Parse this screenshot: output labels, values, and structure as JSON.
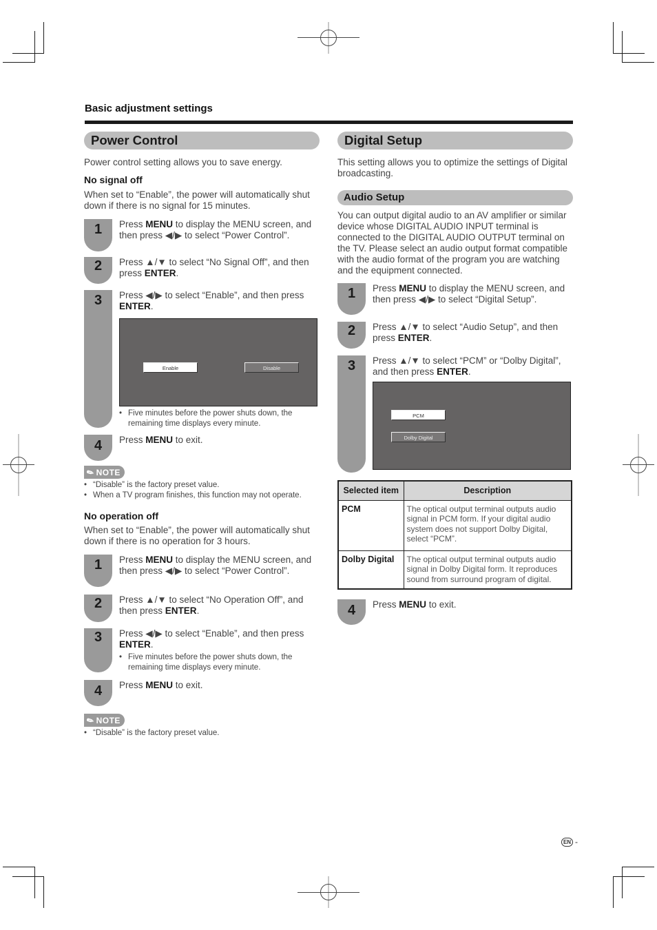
{
  "header": {
    "section_label": "Basic adjustment settings"
  },
  "power_control": {
    "title": "Power Control",
    "intro": "Power control setting allows you to save energy.",
    "no_signal_off": {
      "heading": "No signal off",
      "description": "When set to “Enable”, the power will automatically shut down if there is no signal for 15 minutes.",
      "steps": [
        {
          "num": "1",
          "pre": "Press ",
          "bold1": "MENU",
          "post": " to display the MENU screen, and then press ◀/▶ to select “Power Control”."
        },
        {
          "num": "2",
          "pre": "Press ▲/▼ to select “No Signal Off”, and then press ",
          "bold1": "ENTER",
          "post": "."
        },
        {
          "num": "3",
          "pre": "Press ◀/▶ to select “Enable”, and then press ",
          "bold1": "ENTER",
          "post": "."
        },
        {
          "num": "4",
          "pre": "Press ",
          "bold1": "MENU",
          "post": " to exit."
        }
      ],
      "screen": {
        "options": [
          "Enable",
          "Disable"
        ],
        "selected": "Enable"
      },
      "step3_bullet": "Five minutes before the power shuts down, the remaining time displays every minute.",
      "note_label": "NOTE",
      "notes": [
        "“Disable” is the factory preset value.",
        "When a TV program finishes, this function may not operate."
      ]
    },
    "no_operation_off": {
      "heading": "No operation off",
      "description": "When set to “Enable”, the power will automatically shut down if there is no operation for 3 hours.",
      "steps": [
        {
          "num": "1",
          "pre": "Press ",
          "bold1": "MENU",
          "post": " to display the MENU screen, and then press ◀/▶ to select “Power Control”."
        },
        {
          "num": "2",
          "pre": "Press ▲/▼ to select “No Operation Off”, and then press ",
          "bold1": "ENTER",
          "post": "."
        },
        {
          "num": "3",
          "pre": "Press ◀/▶ to select “Enable”, and then press ",
          "bold1": "ENTER",
          "post": "."
        },
        {
          "num": "4",
          "pre": "Press ",
          "bold1": "MENU",
          "post": " to exit."
        }
      ],
      "step3_bullet": "Five minutes before the power shuts down, the remaining time displays every minute.",
      "note_label": "NOTE",
      "notes": [
        "“Disable” is the factory preset value."
      ]
    }
  },
  "digital_setup": {
    "title": "Digital Setup",
    "intro": "This setting allows you to optimize the settings of Digital broadcasting.",
    "audio_setup": {
      "title": "Audio Setup",
      "description": "You can output digital audio to an AV amplifier or similar device whose DIGITAL AUDIO INPUT terminal is connected to the DIGITAL AUDIO OUTPUT terminal on the TV. Please select an audio output format compatible with the audio format of the program you are watching and the equipment connected.",
      "steps": [
        {
          "num": "1",
          "pre": "Press ",
          "bold1": "MENU",
          "post": " to display the MENU screen, and then press ◀/▶ to select “Digital Setup”."
        },
        {
          "num": "2",
          "pre": "Press ▲/▼ to select “Audio Setup”, and then press ",
          "bold1": "ENTER",
          "post": "."
        },
        {
          "num": "3",
          "pre": "Press ▲/▼ to select “PCM” or “Dolby Digital”, and then press ",
          "bold1": "ENTER",
          "post": "."
        },
        {
          "num": "4",
          "pre": "Press ",
          "bold1": "MENU",
          "post": " to exit."
        }
      ],
      "screen": {
        "options": [
          "PCM",
          "Dolby Digital"
        ],
        "selected": "PCM"
      },
      "table": {
        "headers": [
          "Selected item",
          "Description"
        ],
        "rows": [
          {
            "item": "PCM",
            "description": "The optical output terminal outputs audio signal in PCM form. If your digital audio system does not support Dolby Digital, select “PCM”."
          },
          {
            "item": "Dolby Digital",
            "description": "The optical output terminal outputs audio signal in Dolby Digital form. It reproduces sound from surround program of digital."
          }
        ]
      }
    }
  },
  "footer": {
    "lang_badge": "EN",
    "page_suffix": "-"
  }
}
